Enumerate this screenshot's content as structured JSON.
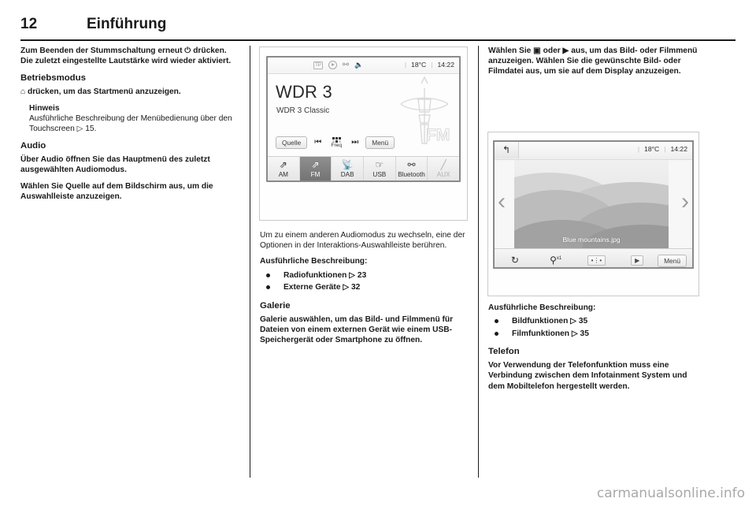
{
  "header": {
    "page_number": "12",
    "chapter": "Einführung"
  },
  "column1": {
    "intro_paragraph": "Zum Beenden der Stummschaltung erneut ⏻ drücken. Die zuletzt eingestellte Lautstärke wird wieder aktiviert.",
    "section_betriebsmodus": "Betriebsmodus",
    "betriebsmodus_paragraph": "⌂ drücken, um das Startmenü anzuzeigen.",
    "note_title": "Hinweis",
    "note_body": "Ausführliche Beschreibung der Menübedienung über den Touchscreen ▷ 15.",
    "section_audio": "Audio",
    "audio_paragraph_1": "Über Audio öffnen Sie das Hauptmenü des zuletzt ausgewählten Audiomodus.",
    "audio_paragraph_2": "Wählen Sie Quelle auf dem Bildschirm aus, um die Auswahlleiste anzuzeigen."
  },
  "column2": {
    "paragraph_switch_mode": "Um zu einem anderen Audiomodus zu wechseln, eine der Optionen in der Interaktions-Auswahlleiste berühren.",
    "detailed_label": "Ausführliche Beschreibung:",
    "detail_items": [
      {
        "label": "Radiofunktionen",
        "arrow": "▷",
        "page": "23"
      },
      {
        "label": "Externe Geräte",
        "arrow": "▷",
        "page": "32"
      }
    ],
    "section_galerie": "Galerie",
    "galerie_paragraph": "Galerie auswählen, um das Bild- und Filmmenü für Dateien von einem externen Gerät wie einem USB-Speichergerät oder Smartphone zu öffnen."
  },
  "column3": {
    "paragraph_select_media": "Wählen Sie ▣ oder ▶ aus, um das Bild- oder Filmmenü anzuzeigen. Wählen Sie die gewünschte Bild- oder Filmdatei aus, um sie auf dem Display anzuzeigen.",
    "detailed_label": "Ausführliche Beschreibung:",
    "detail_items": [
      {
        "label": "Bildfunktionen",
        "arrow": "▷",
        "page": "35"
      },
      {
        "label": "Filmfunktionen",
        "arrow": "▷",
        "page": "35"
      }
    ],
    "section_telefon": "Telefon",
    "telefon_paragraph": "Vor Verwendung der Telefonfunktion muss eine Verbindung zwischen dem Infotainment System und dem Mobiltelefon hergestellt werden."
  },
  "radio_screen": {
    "status": {
      "tp_label": "TP",
      "icons": [
        "tp-icon",
        "traffic-announcement-icon",
        "bluetooth-icon",
        "mute-speaker-icon"
      ],
      "temperature": "18°C",
      "time": "14:22"
    },
    "station_name": "WDR 3",
    "station_subtitle": "WDR 3 Classic",
    "source_button": "Quelle",
    "prev_icon": "⏮",
    "freq_label": "Freq",
    "next_icon": "⏭",
    "menu_button": "Menü",
    "logo_text": "FM",
    "tabs": [
      {
        "label": "AM",
        "icon": "antenna-icon",
        "active": false,
        "dim": false
      },
      {
        "label": "FM",
        "icon": "antenna-icon",
        "active": true,
        "dim": false
      },
      {
        "label": "DAB",
        "icon": "satellite-icon",
        "active": false,
        "dim": false
      },
      {
        "label": "USB",
        "icon": "usb-icon",
        "active": false,
        "dim": false
      },
      {
        "label": "Bluetooth",
        "icon": "bluetooth-icon",
        "active": false,
        "dim": false
      },
      {
        "label": "AUX",
        "icon": "aux-jack-icon",
        "active": false,
        "dim": true
      }
    ]
  },
  "gallery_screen": {
    "back_icon": "↰",
    "temperature": "18°C",
    "time": "14:22",
    "filename": "Blue mountains.jpg",
    "prev_chevron": "‹",
    "next_chevron": "›",
    "toolbar": {
      "rotate_icon": "↻",
      "zoom_icon": "⚲",
      "zoom_level": "x1",
      "effects_icon": "effects-icon",
      "slideshow_icon": "▶",
      "menu_button": "Menü"
    }
  },
  "watermark": "carmanualsonline.info"
}
